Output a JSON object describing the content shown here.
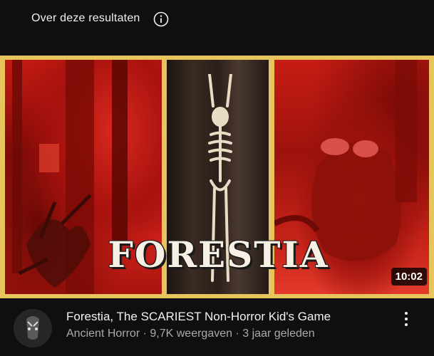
{
  "header": {
    "about_label": "Over deze resultaten",
    "info_icon": "info-icon"
  },
  "thumbnail": {
    "overlay_title": "FORESTIA",
    "duration": "10:02",
    "border_color": "#e8c55c",
    "panel_tint": "#c11a12"
  },
  "video": {
    "title": "Forestia, The SCARIEST Non-Horror Kid's Game",
    "channel": "Ancient Horror",
    "views": "9,7K weergaven",
    "age": "3 jaar geleden",
    "separator": "·",
    "more_icon": "more-vert-icon"
  }
}
